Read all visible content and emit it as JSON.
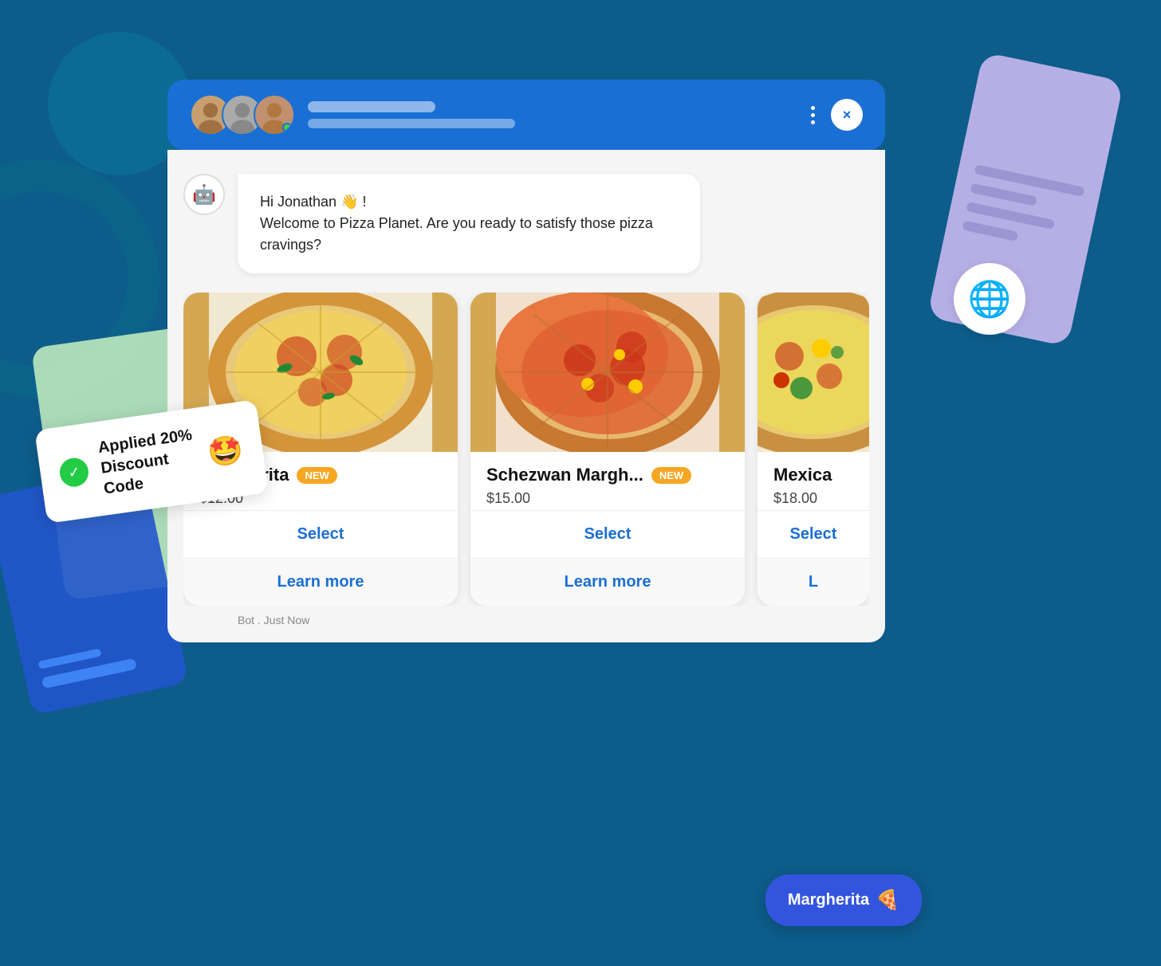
{
  "background": {
    "color": "#0d5c8a"
  },
  "chat": {
    "header": {
      "close_label": "×",
      "title_bar1": "",
      "title_bar2": ""
    },
    "bot_message": {
      "greeting": "Hi Jonathan 👋 !",
      "body": "Welcome to Pizza Planet. Are you ready to satisfy those pizza cravings?",
      "timestamp": "Bot . Just Now"
    },
    "products": [
      {
        "name": "Margherita",
        "badge": "NEW",
        "price": "$12.00",
        "select_label": "Select",
        "learn_label": "Learn more",
        "color": "#d4853a"
      },
      {
        "name": "Schezwan Margh...",
        "badge": "NEW",
        "price": "$15.00",
        "select_label": "Select",
        "learn_label": "Learn more",
        "color": "#cc5533"
      },
      {
        "name": "Mexica",
        "badge": "",
        "price": "$18.00",
        "select_label": "Select",
        "learn_label": "L",
        "color": "#dd8822"
      }
    ]
  },
  "discount": {
    "text": "Applied 20%\nDiscount Code",
    "emoji": "🤩"
  },
  "bottom_chip": {
    "label": "Margherita",
    "emoji": "🍕"
  },
  "icons": {
    "bot": "🤖",
    "globe": "🌐",
    "check": "✓"
  }
}
